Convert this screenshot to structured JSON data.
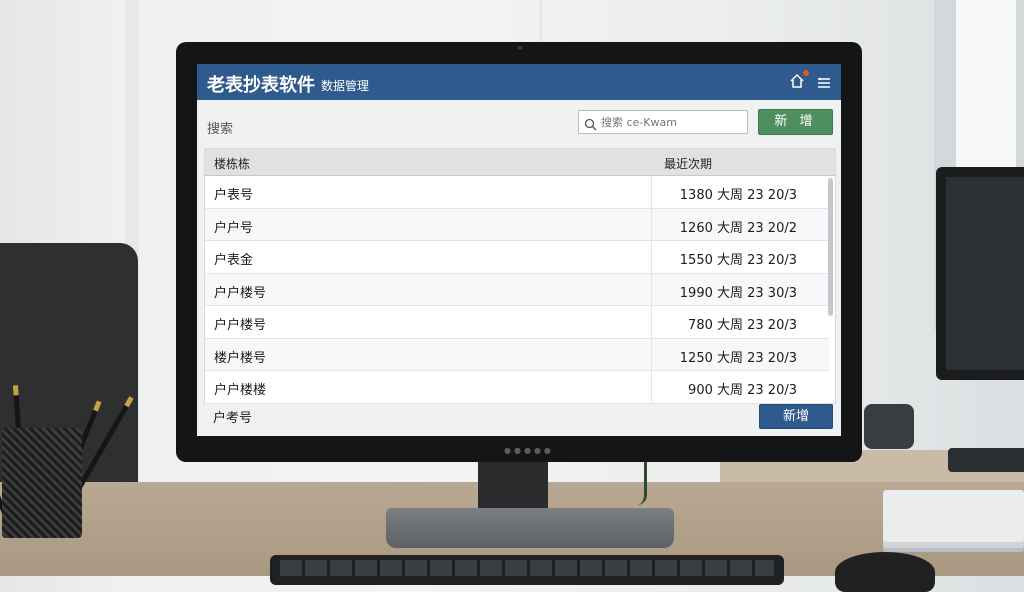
{
  "header": {
    "app_title": "老表抄表软件",
    "subtitle": "数据管理"
  },
  "toolbar": {
    "search_label": "搜索",
    "search_placeholder": "搜索 ce-Kwam",
    "add_button": "新 增"
  },
  "table": {
    "columns": [
      "楼栋栋",
      "最近次期"
    ],
    "rows": [
      {
        "name": "户表号",
        "value": "1380 大周 23 20/3"
      },
      {
        "name": "户户号",
        "value": "1260 大周 23 20/2"
      },
      {
        "name": "户表金",
        "value": "1550 大周 23 20/3"
      },
      {
        "name": "户户楼号",
        "value": "1990 大周 23 30/3"
      },
      {
        "name": "户户楼号",
        "value": "780 大周 23 20/3"
      },
      {
        "name": "楼户楼号",
        "value": "1250 大周 23 20/3"
      },
      {
        "name": "户户楼楼",
        "value": "900 大周 23 20/3"
      }
    ]
  },
  "footer": {
    "label": "户考号",
    "add_button": "新增"
  },
  "colors": {
    "title_bar": "#2e5a8e",
    "add_top": "#4f8f5e",
    "add_bottom": "#2e5a8e",
    "notify_dot": "#e8542c"
  },
  "icons": {
    "home": "home-icon",
    "menu": "menu-icon",
    "search": "search-icon"
  }
}
